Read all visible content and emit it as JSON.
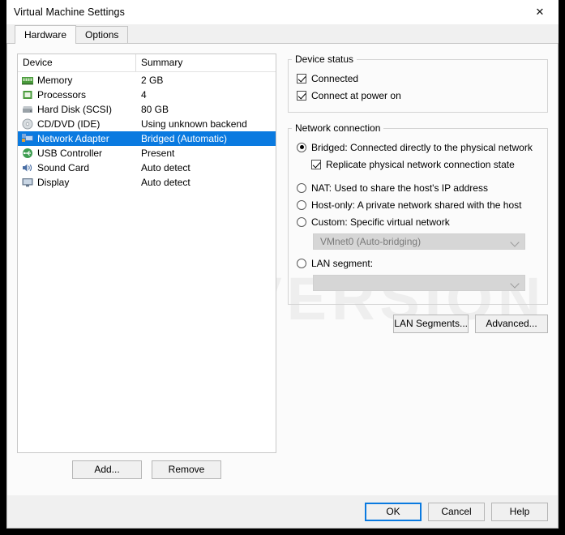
{
  "window": {
    "title": "Virtual Machine Settings",
    "close_icon": "close-icon",
    "watermark": "DEMO VERSION"
  },
  "tabs": [
    {
      "label": "Hardware",
      "active": true
    },
    {
      "label": "Options",
      "active": false
    }
  ],
  "device_list": {
    "columns": [
      "Device",
      "Summary"
    ],
    "rows": [
      {
        "icon": "memory-icon",
        "device": "Memory",
        "summary": "2 GB",
        "selected": false
      },
      {
        "icon": "processor-icon",
        "device": "Processors",
        "summary": "4",
        "selected": false
      },
      {
        "icon": "hard-disk-icon",
        "device": "Hard Disk (SCSI)",
        "summary": "80 GB",
        "selected": false
      },
      {
        "icon": "cd-dvd-icon",
        "device": "CD/DVD (IDE)",
        "summary": "Using unknown backend",
        "selected": false
      },
      {
        "icon": "network-adapter-icon",
        "device": "Network Adapter",
        "summary": "Bridged (Automatic)",
        "selected": true
      },
      {
        "icon": "usb-controller-icon",
        "device": "USB Controller",
        "summary": "Present",
        "selected": false
      },
      {
        "icon": "sound-card-icon",
        "device": "Sound Card",
        "summary": "Auto detect",
        "selected": false
      },
      {
        "icon": "display-icon",
        "device": "Display",
        "summary": "Auto detect",
        "selected": false
      }
    ],
    "add_label": "Add...",
    "remove_label": "Remove"
  },
  "device_status": {
    "legend": "Device status",
    "connected": {
      "label": "Connected",
      "checked": true
    },
    "connect_at_power_on": {
      "label": "Connect at power on",
      "checked": true
    }
  },
  "network_connection": {
    "legend": "Network connection",
    "options": [
      {
        "label": "Bridged: Connected directly to the physical network",
        "selected": true
      },
      {
        "label": "NAT: Used to share the host's IP address",
        "selected": false
      },
      {
        "label": "Host-only: A private network shared with the host",
        "selected": false
      },
      {
        "label": "Custom: Specific virtual network",
        "selected": false
      },
      {
        "label": "LAN segment:",
        "selected": false
      }
    ],
    "replicate": {
      "label": "Replicate physical network connection state",
      "checked": true
    },
    "custom_network_value": "VMnet0 (Auto-bridging)",
    "lan_segment_value": "",
    "lan_segments_button": "LAN Segments...",
    "advanced_button": "Advanced..."
  },
  "footer": {
    "ok": "OK",
    "cancel": "Cancel",
    "help": "Help"
  },
  "colors": {
    "selection": "#0a7ae0",
    "window_bg": "#f0f0f0",
    "content_bg": "#fbfbfb",
    "watermark": "#eeeeee"
  }
}
